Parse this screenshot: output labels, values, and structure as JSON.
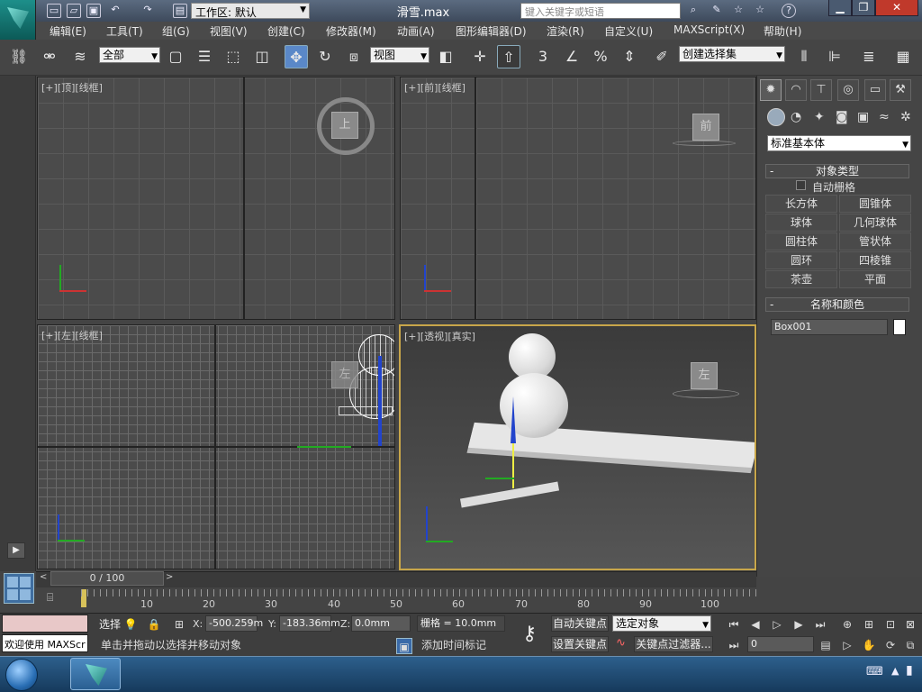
{
  "title_bar": {
    "workspace_label": "工作区: 默认",
    "file_name": "滑雪.max",
    "search_placeholder": "键入关键字或短语",
    "help_label": "?"
  },
  "menu": {
    "items": [
      "编辑(E)",
      "工具(T)",
      "组(G)",
      "视图(V)",
      "创建(C)",
      "修改器(M)",
      "动画(A)",
      "图形编辑器(D)",
      "渲染(R)",
      "自定义(U)",
      "MAXScript(X)",
      "帮助(H)"
    ]
  },
  "toolbar": {
    "selection_filter": "全部",
    "reference_coord": "视图",
    "snap_label": "3",
    "named_selection_placeholder": "创建选择集"
  },
  "viewports": {
    "top": {
      "label": "[+][顶][线框]",
      "cube": "上"
    },
    "front": {
      "label": "[+][前][线框]",
      "cube": "前"
    },
    "left": {
      "label": "[+][左][线框]",
      "cube": "左"
    },
    "perspective": {
      "label": "[+][透视][真实]",
      "cube": "左"
    }
  },
  "command_panel": {
    "category": "标准基本体",
    "object_type_header": "对象类型",
    "auto_grid": "自动栅格",
    "buttons": [
      "长方体",
      "圆锥体",
      "球体",
      "几何球体",
      "圆柱体",
      "管状体",
      "圆环",
      "四棱锥",
      "茶壶",
      "平面"
    ],
    "name_color_header": "名称和颜色",
    "object_name": "Box001",
    "object_color": "#ffffff"
  },
  "timeline": {
    "frame_readout": "0 / 100",
    "ticks": [
      "10",
      "20",
      "30",
      "40",
      "50",
      "60",
      "70",
      "80",
      "90",
      "100"
    ]
  },
  "status": {
    "maxscript_listener": "欢迎使用 MAXScr",
    "selection_label": "选择",
    "x_label": "X:",
    "x_value": "-500.259m",
    "y_label": "Y:",
    "y_value": "-183.36mm",
    "z_label": "Z:",
    "z_value": "0.0mm",
    "grid": "栅格 = 10.0mm",
    "prompt": "单击并拖动以选择并移动对象",
    "add_time_tag": "添加时间标记",
    "auto_key": "自动关键点",
    "set_key": "设置关键点",
    "key_mode": "选定对象",
    "key_filters": "关键点过滤器...",
    "current_frame": "0"
  },
  "colors": {
    "accent": "#5a88c8",
    "active_viewport_border": "#c8a64a",
    "axis_x": "#cc3333",
    "axis_y": "#22aa22",
    "axis_z": "#2244cc"
  }
}
